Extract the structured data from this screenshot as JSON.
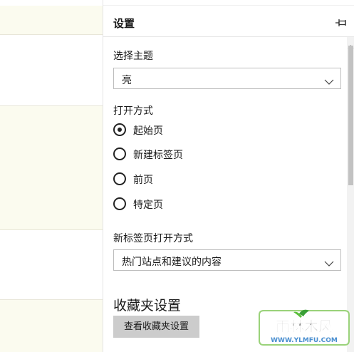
{
  "panel": {
    "title": "设置",
    "pin_icon": "pin-icon"
  },
  "theme": {
    "label": "选择主题",
    "selected": "亮"
  },
  "open_with": {
    "label": "打开方式",
    "options": [
      {
        "label": "起始页",
        "selected": true
      },
      {
        "label": "新建标签页",
        "selected": false
      },
      {
        "label": "前页",
        "selected": false
      },
      {
        "label": "特定页",
        "selected": false
      }
    ]
  },
  "new_tab": {
    "label": "新标签页打开方式",
    "selected": "热门站点和建议的内容"
  },
  "favorites": {
    "heading": "收藏夹设置",
    "button_label": "查看收藏夹设置"
  },
  "watermark": {
    "text": "雨林木风",
    "url": "WWW.YLMFU.COM"
  },
  "colors": {
    "left_cream": "#fbfbef",
    "button_gray": "#cccccc",
    "scroll_thumb": "#c2c2c2"
  }
}
